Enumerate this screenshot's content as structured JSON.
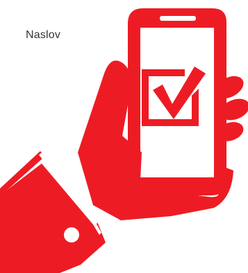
{
  "header": {
    "title": "Naslov"
  },
  "illustration": {
    "icon": "hand-holding-phone-checkmark-icon",
    "accent_color": "#ed1c24",
    "background_color": "#ffffff"
  }
}
